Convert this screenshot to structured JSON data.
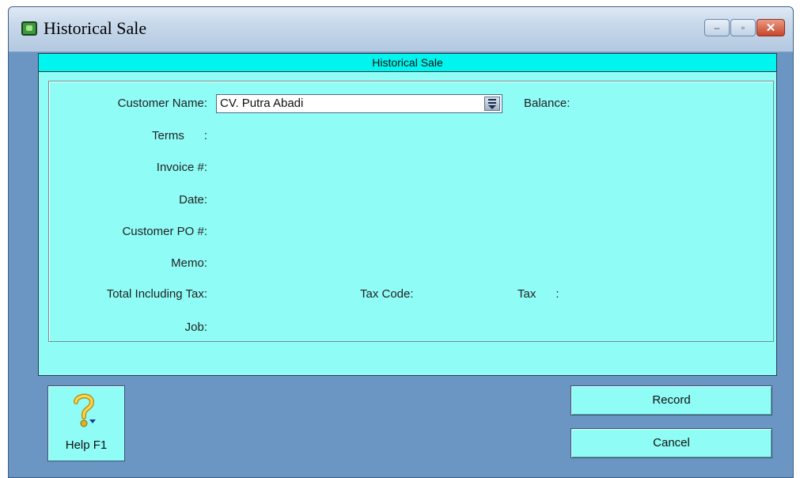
{
  "window": {
    "title": "Historical Sale",
    "controls": {
      "minimize": "–",
      "maximize": "▫",
      "close": "✕"
    }
  },
  "panel": {
    "header": "Historical Sale"
  },
  "form": {
    "customer_name_label": "Customer Name:",
    "customer_name_value": "CV. Putra Abadi",
    "balance_label": "Balance:",
    "terms_label": "Terms      :",
    "invoice_label": "Invoice #:",
    "date_label": "Date:",
    "customer_po_label": "Customer PO #:",
    "memo_label": "Memo:",
    "total_label": "Total Including Tax:",
    "tax_code_label": "Tax Code:",
    "tax_label": "Tax      :",
    "job_label": "Job:"
  },
  "buttons": {
    "help_label": "Help F1",
    "record_label": "Record",
    "cancel_label": "Cancel"
  },
  "icons": {
    "app": "app-icon",
    "help": "question-mark-icon",
    "combo": "list-dropdown-icon"
  },
  "colors": {
    "frame": "#6b95c2",
    "panel": "#8ffcf6",
    "header": "#00f5ef"
  }
}
